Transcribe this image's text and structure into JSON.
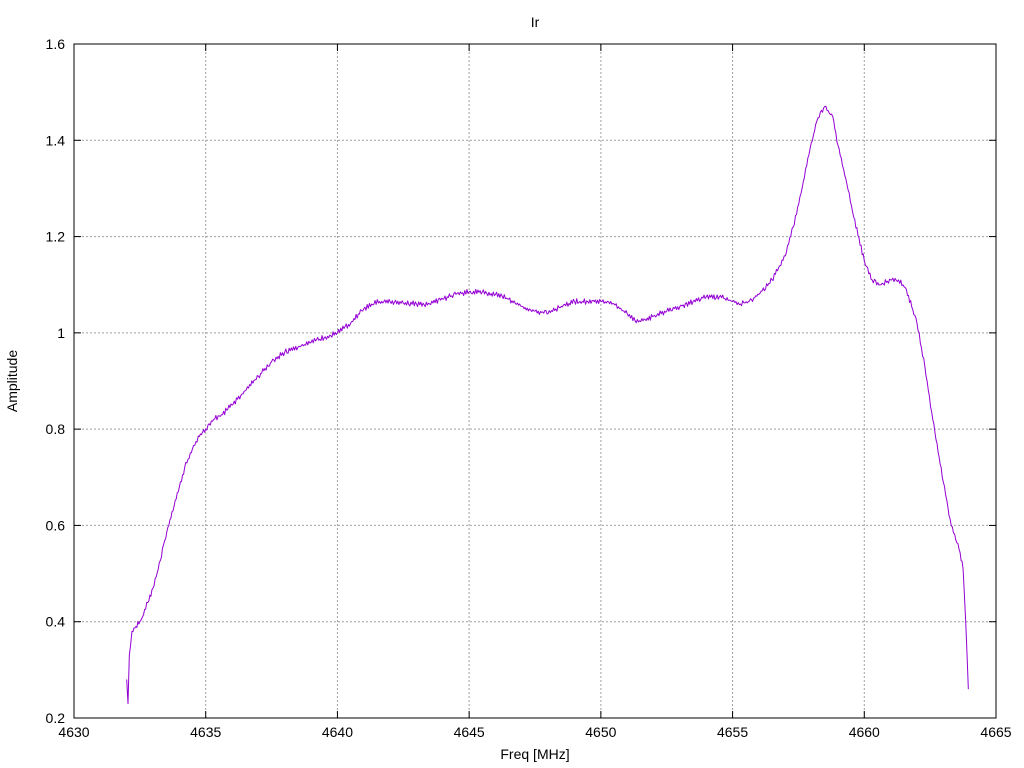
{
  "chart_data": {
    "type": "line",
    "title": "Ir",
    "xlabel": "Freq [MHz]",
    "ylabel": "Amplitude",
    "xlim": [
      4630,
      4665
    ],
    "ylim": [
      0.2,
      1.6
    ],
    "xticks": [
      4630,
      4635,
      4640,
      4645,
      4650,
      4655,
      4660,
      4665
    ],
    "yticks": [
      0.2,
      0.4,
      0.6,
      0.8,
      1.0,
      1.2,
      1.4,
      1.6
    ],
    "xtick_labels": [
      "4630",
      "4635",
      "4640",
      "4645",
      "4650",
      "4655",
      "4660",
      "4665"
    ],
    "ytick_labels": [
      "0.2",
      "0.4",
      "0.6",
      "0.8",
      "1",
      "1.2",
      "1.4",
      "1.6"
    ],
    "grid": true,
    "legend": "none",
    "line_color": "#9400d3",
    "series": [
      {
        "x": [
          4632.0,
          4632.05,
          4632.1,
          4632.2,
          4632.35,
          4632.5,
          4632.6,
          4632.8,
          4633.0,
          4633.2,
          4633.4,
          4633.6,
          4633.8,
          4634.0,
          4634.2,
          4634.5,
          4634.8,
          4635.0,
          4635.3,
          4635.6,
          4636.0,
          4636.5,
          4637.0,
          4637.5,
          4638.0,
          4638.5,
          4639.0,
          4639.5,
          4640.0,
          4640.5,
          4641.0,
          4641.3,
          4641.6,
          4642.0,
          4642.5,
          4643.0,
          4643.5,
          4644.0,
          4644.5,
          4645.0,
          4645.5,
          4646.0,
          4646.5,
          4647.0,
          4647.5,
          4648.0,
          4648.5,
          4649.0,
          4649.5,
          4650.0,
          4650.5,
          4651.0,
          4651.3,
          4651.6,
          4652.0,
          4652.5,
          4653.0,
          4653.5,
          4654.0,
          4654.5,
          4655.0,
          4655.3,
          4655.6,
          4656.0,
          4656.5,
          4657.0,
          4657.3,
          4657.6,
          4657.9,
          4658.2,
          4658.5,
          4658.8,
          4659.0,
          4659.3,
          4659.6,
          4660.0,
          4660.3,
          4660.6,
          4661.0,
          4661.3,
          4661.6,
          4662.0,
          4662.3,
          4662.6,
          4663.0,
          4663.3,
          4663.6,
          4663.75,
          4663.85,
          4663.95
        ],
        "y": [
          0.28,
          0.23,
          0.33,
          0.38,
          0.39,
          0.4,
          0.41,
          0.44,
          0.47,
          0.51,
          0.56,
          0.6,
          0.64,
          0.68,
          0.72,
          0.76,
          0.79,
          0.8,
          0.82,
          0.83,
          0.85,
          0.88,
          0.91,
          0.94,
          0.96,
          0.97,
          0.98,
          0.99,
          1.0,
          1.02,
          1.05,
          1.06,
          1.065,
          1.065,
          1.062,
          1.06,
          1.06,
          1.07,
          1.08,
          1.085,
          1.085,
          1.08,
          1.07,
          1.055,
          1.045,
          1.04,
          1.055,
          1.065,
          1.065,
          1.065,
          1.06,
          1.04,
          1.025,
          1.025,
          1.035,
          1.045,
          1.055,
          1.065,
          1.075,
          1.075,
          1.065,
          1.06,
          1.065,
          1.08,
          1.11,
          1.16,
          1.22,
          1.29,
          1.37,
          1.44,
          1.47,
          1.45,
          1.39,
          1.32,
          1.24,
          1.15,
          1.11,
          1.1,
          1.11,
          1.11,
          1.09,
          1.02,
          0.93,
          0.82,
          0.69,
          0.6,
          0.55,
          0.51,
          0.4,
          0.26
        ]
      }
    ]
  }
}
